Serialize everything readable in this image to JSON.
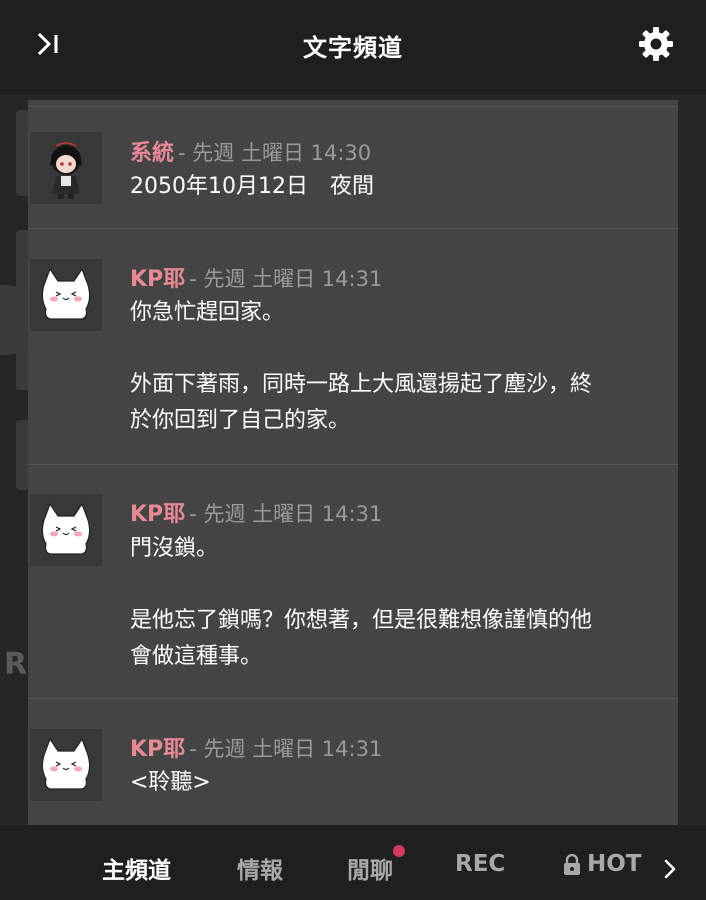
{
  "header": {
    "title": "文字頻道",
    "collapse_icon": "collapse-panel-icon",
    "settings_icon": "gear-icon"
  },
  "background": {
    "letter": "R"
  },
  "messages": [
    {
      "author": "系統",
      "time": "- 先週 土曜日 14:30",
      "avatar": "chibi-character-avatar",
      "lines": [
        "2050年10月12日　夜間"
      ]
    },
    {
      "author": "KP耶",
      "time": "- 先週 土曜日 14:31",
      "avatar": "white-cat-avatar",
      "lines": [
        "你急忙趕回家。",
        "",
        "外面下著雨，同時一路上大風還揚起了塵沙，終",
        "於你回到了自己的家。"
      ]
    },
    {
      "author": "KP耶",
      "time": "- 先週 土曜日 14:31",
      "avatar": "white-cat-avatar",
      "lines": [
        "門沒鎖。",
        "",
        "是他忘了鎖嗎？你想著，但是很難想像謹慎的他",
        "會做這種事。"
      ]
    },
    {
      "author": "KP耶",
      "time": "- 先週 土曜日 14:31",
      "avatar": "white-cat-avatar",
      "lines": [
        "<聆聽>"
      ]
    }
  ],
  "tabs": [
    {
      "label": "主頻道",
      "active": true
    },
    {
      "label": "情報",
      "active": false
    },
    {
      "label": "閒聊",
      "active": false,
      "unread": true
    },
    {
      "label": "REC",
      "active": false
    },
    {
      "label": "HOT",
      "active": false,
      "locked": true
    }
  ],
  "colors": {
    "author": "#e88a96",
    "unread_dot": "#d43a5e",
    "topbar": "#1f1f1f",
    "panel": "#444444"
  }
}
